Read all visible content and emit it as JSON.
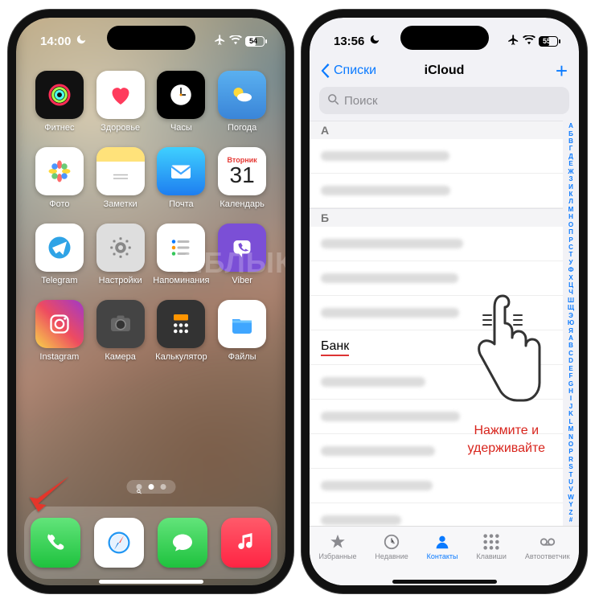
{
  "left_phone": {
    "status": {
      "time": "14:00",
      "moon": true,
      "airplane": true,
      "wifi": true,
      "battery_pct": "54",
      "theme": "light"
    },
    "apps": [
      {
        "label": "Фитнес",
        "tile": "t-fitness",
        "icon": "rings"
      },
      {
        "label": "Здоровье",
        "tile": "t-health",
        "icon": "heart"
      },
      {
        "label": "Часы",
        "tile": "t-clock",
        "icon": "clock"
      },
      {
        "label": "Погода",
        "tile": "t-weather",
        "icon": "weather"
      },
      {
        "label": "Фото",
        "tile": "t-photos",
        "icon": "flower"
      },
      {
        "label": "Заметки",
        "tile": "t-notes",
        "icon": "notes"
      },
      {
        "label": "Почта",
        "tile": "t-mail",
        "icon": "mail"
      },
      {
        "label": "Календарь",
        "tile": "t-cal",
        "icon": "calendar",
        "day_name": "Вторник",
        "day_num": "31"
      },
      {
        "label": "Telegram",
        "tile": "t-telegram",
        "icon": "telegram"
      },
      {
        "label": "Настройки",
        "tile": "t-settings",
        "icon": "gear"
      },
      {
        "label": "Напоминания",
        "tile": "t-reminders",
        "icon": "list"
      },
      {
        "label": "Viber",
        "tile": "t-viber",
        "icon": "viber"
      },
      {
        "label": "Instagram",
        "tile": "t-instagram",
        "icon": "instagram"
      },
      {
        "label": "Камера",
        "tile": "t-camera",
        "icon": "camera"
      },
      {
        "label": "Калькулятор",
        "tile": "t-calc",
        "icon": "calc"
      },
      {
        "label": "Файлы",
        "tile": "t-files",
        "icon": "folder"
      }
    ],
    "dock": [
      {
        "name": "phone",
        "tile": "t-phone",
        "icon": "phone"
      },
      {
        "name": "safari",
        "tile": "t-safari",
        "icon": "safari"
      },
      {
        "name": "messages",
        "tile": "t-messages",
        "icon": "messages"
      },
      {
        "name": "music",
        "tile": "t-music",
        "icon": "music"
      }
    ],
    "watermark": "ЯБЛЫК"
  },
  "right_phone": {
    "status": {
      "time": "13:56",
      "moon": true,
      "airplane": true,
      "wifi": true,
      "battery_pct": "55",
      "theme": "dark"
    },
    "nav": {
      "back": "Списки",
      "title": "iCloud",
      "add": "+"
    },
    "search_placeholder": "Поиск",
    "sections": [
      {
        "letter": "А",
        "rows": 2
      },
      {
        "letter": "Б",
        "rows": 4,
        "highlight_index": 3,
        "highlight_text": "Банк",
        "rows_after": 5
      }
    ],
    "index_letters": [
      "А",
      "Б",
      "В",
      "Г",
      "Д",
      "Е",
      "Ж",
      "З",
      "И",
      "К",
      "Л",
      "М",
      "Н",
      "О",
      "П",
      "Р",
      "С",
      "Т",
      "У",
      "Ф",
      "Х",
      "Ц",
      "Ч",
      "Ш",
      "Щ",
      "Э",
      "Ю",
      "Я",
      "A",
      "B",
      "C",
      "D",
      "E",
      "F",
      "G",
      "H",
      "I",
      "J",
      "K",
      "L",
      "M",
      "N",
      "O",
      "P",
      "R",
      "S",
      "T",
      "U",
      "V",
      "W",
      "Y",
      "Z",
      "#"
    ],
    "tabs": [
      {
        "icon": "star",
        "label": "Избранные",
        "active": false
      },
      {
        "icon": "clock",
        "label": "Недавние",
        "active": false
      },
      {
        "icon": "contact",
        "label": "Контакты",
        "active": true
      },
      {
        "icon": "keypad",
        "label": "Клавиши",
        "active": false
      },
      {
        "icon": "voicemail",
        "label": "Автоответчик",
        "active": false
      }
    ],
    "annotation": "Нажмите и\nудерживайте"
  }
}
